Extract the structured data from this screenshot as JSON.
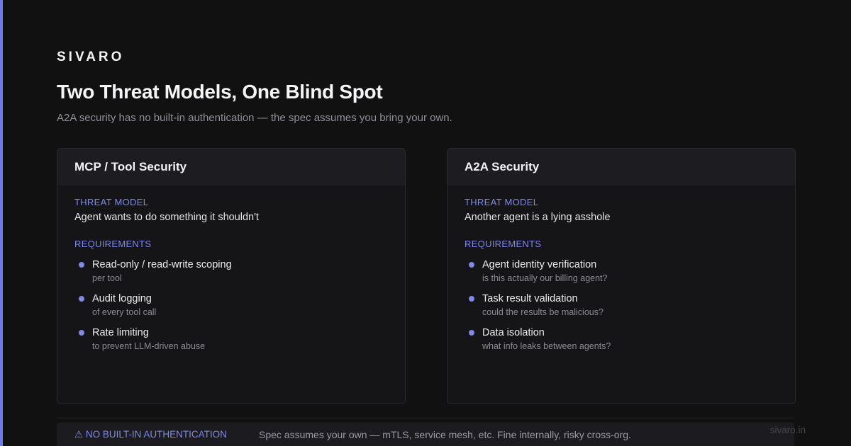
{
  "brand": "SIVARO",
  "title": "Two Threat Models, One Blind Spot",
  "subtitle": "A2A security has no built-in authentication — the spec assumes you bring your own.",
  "colors": {
    "accent": "#6f7cf0",
    "label": "#7f88e8",
    "background": "#111112"
  },
  "cards": [
    {
      "title": "MCP / Tool Security",
      "threat_label": "THREAT MODEL",
      "threat": "Agent wants to do something it shouldn't",
      "requirements_label": "REQUIREMENTS",
      "requirements": [
        {
          "title": "Read-only / read-write scoping",
          "detail": "per tool"
        },
        {
          "title": "Audit logging",
          "detail": "of every tool call"
        },
        {
          "title": "Rate limiting",
          "detail": "to prevent LLM-driven abuse"
        }
      ]
    },
    {
      "title": "A2A Security",
      "threat_label": "THREAT MODEL",
      "threat": "Another agent is a lying asshole",
      "requirements_label": "REQUIREMENTS",
      "requirements": [
        {
          "title": "Agent identity verification",
          "detail": "is this actually our billing agent?"
        },
        {
          "title": "Task result validation",
          "detail": "could the results be malicious?"
        },
        {
          "title": "Data isolation",
          "detail": "what info leaks between agents?"
        }
      ]
    }
  ],
  "footer": {
    "label": "⚠ NO BUILT-IN AUTHENTICATION",
    "text": "Spec assumes your own — mTLS, service mesh, etc. Fine internally, risky cross-org."
  },
  "site": "sivaro.in"
}
